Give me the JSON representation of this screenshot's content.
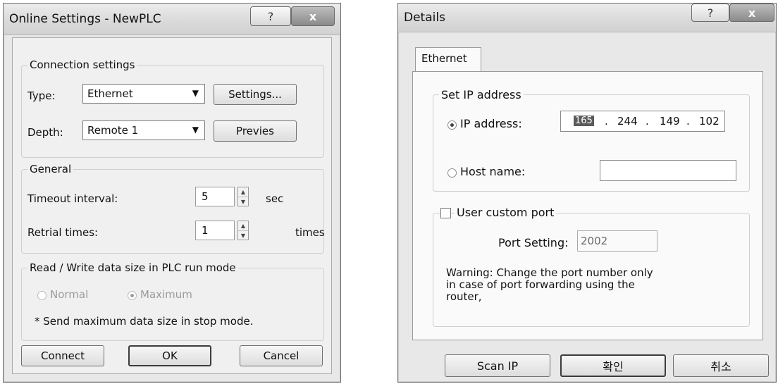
{
  "online_settings": {
    "title": "Online Settings - NewPLC",
    "help_glyph": "?",
    "close_glyph": "x",
    "connection": {
      "group_label": "Connection settings",
      "type_label": "Type:",
      "type_value": "Ethernet",
      "settings_button": "Settings...",
      "depth_label": "Depth:",
      "depth_value": "Remote 1",
      "previes_button": "Previes"
    },
    "general": {
      "group_label": "General",
      "timeout_label": "Timeout interval:",
      "timeout_value": "5",
      "timeout_unit": "sec",
      "retrial_label": "Retrial times:",
      "retrial_value": "1",
      "retrial_unit": "times"
    },
    "rw_size": {
      "group_label": "Read / Write data size in PLC run mode",
      "normal_label": "Normal",
      "maximum_label": "Maximum",
      "selected": "Maximum",
      "note": "* Send maximum data size in stop mode."
    },
    "buttons": {
      "connect": "Connect",
      "ok": "OK",
      "cancel": "Cancel"
    }
  },
  "details": {
    "title": "Details",
    "help_glyph": "?",
    "close_glyph": "x",
    "tab_label": "Ethernet",
    "ip_group_label": "Set IP address",
    "ip_radio_label": "IP address:",
    "ip_octets": [
      "165",
      "244",
      "149",
      "102"
    ],
    "ip_separator": ".",
    "host_radio_label": "Host name:",
    "host_value": "",
    "selected_mode": "IP address",
    "custom_port_label": "User custom port",
    "custom_port_checked": false,
    "port_setting_label": "Port Setting:",
    "port_value": "2002",
    "warning": "Warning: Change the port number only in case of port forwarding using the router,",
    "buttons": {
      "scan_ip": "Scan IP",
      "ok": "확인",
      "cancel": "취소"
    }
  }
}
